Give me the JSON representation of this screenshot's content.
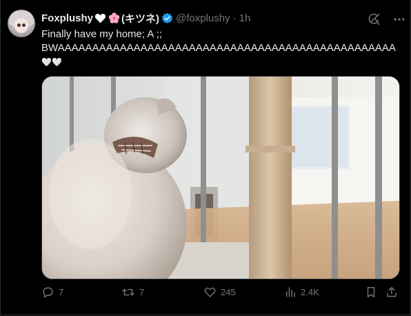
{
  "author": {
    "display_name": "Foxplushy",
    "emoji_heart": "white-heart",
    "emoji_flower": "cherry-blossom",
    "name_suffix": "(キツネ)",
    "verified": true,
    "handle": "@foxplushy",
    "separator": "·",
    "time": "1h"
  },
  "tweet": {
    "line1": "Finally have my home; A ;;",
    "line2": "BWAAAAAAAAAAAAAAAAAAAAAAAAAAAAAAAAAAAAAAAAAAAAAAAAA",
    "line3": "🤍🤍"
  },
  "media": {
    "description_icon": "photo",
    "subject": "fluffy cat looking through stair railing"
  },
  "actions": {
    "replies": "7",
    "reposts": "7",
    "likes": "245",
    "views": "2.4K"
  },
  "colors": {
    "background": "#000000",
    "text": "#e7e9ea",
    "muted": "#71767b",
    "verified": "#1d9bf0",
    "border": "#2f3336"
  }
}
